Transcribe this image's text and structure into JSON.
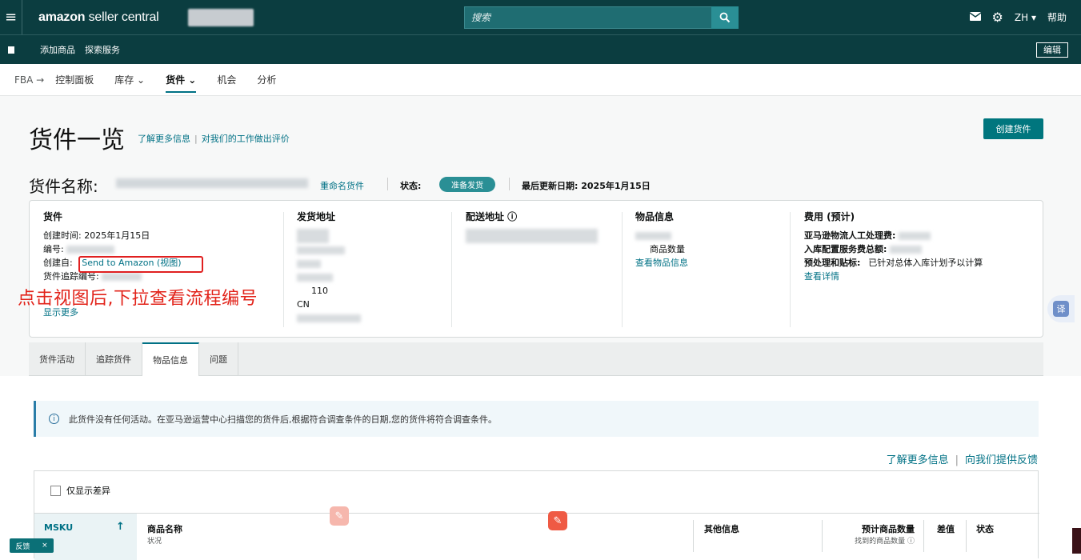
{
  "topbar": {
    "logo_main": "amazon",
    "logo_rest": " seller central",
    "search_placeholder": "搜索",
    "lang": "ZH ▾",
    "help": "帮助"
  },
  "subbar": {
    "links": [
      "添加商品",
      "探索服务"
    ],
    "edit": "编辑"
  },
  "nav": {
    "root": "FBA →",
    "items": [
      "控制面板",
      "库存 ⌄",
      "货件 ⌄",
      "机会",
      "分析"
    ]
  },
  "header": {
    "title": "货件一览",
    "learn_more": "了解更多信息",
    "sep": "|",
    "rate": "对我们的工作做出评价",
    "create_button": "创建货件"
  },
  "shipment": {
    "name_label": "货件名称:",
    "rename": "重命名货件",
    "status_label": "状态:",
    "status_value": "准备发货",
    "updated": "最后更新日期: 2025年1月15日"
  },
  "card": {
    "shipment": {
      "title": "货件",
      "created_time": "创建时间: 2025年1月15日",
      "number_label": "编号:",
      "created_from_label": "创建自:",
      "created_from_link": "Send to Amazon (视图)",
      "tracking_label": "货件追踪编号:",
      "show_more": "显示更多"
    },
    "ship_from": {
      "title": "发货地址",
      "postal": "110",
      "country": "CN"
    },
    "ship_to": {
      "title": "配送地址 ⓘ"
    },
    "items": {
      "title": "物品信息",
      "qty_label": "商品数量",
      "view_link": "查看物品信息"
    },
    "fees": {
      "title": "费用 (预计)",
      "labor": "亚马逊物流人工处理费:",
      "placement": "入库配置服务费总额:",
      "prep": "预处理和贴标:",
      "prep_value": "已针对总体入库计划予以计算",
      "details": "查看详情"
    }
  },
  "annotation": "点击视图后,下拉查看流程编号",
  "tabs": [
    "货件活动",
    "追踪货件",
    "物品信息",
    "问题"
  ],
  "alert": {
    "icon": "info-icon",
    "text": "此货件没有任何活动。在亚马逊运营中心扫描您的货件后,根据符合调查条件的日期,您的货件将符合调查条件。"
  },
  "links2": {
    "learn_more": "了解更多信息",
    "sep": "|",
    "feedback": "向我们提供反馈"
  },
  "table": {
    "only_diff": "仅显示差异",
    "columns": {
      "msku": "MSKU",
      "sort": "↑",
      "name": "商品名称",
      "name_sub": "状况",
      "other": "其他信息",
      "expected": "预计商品数量",
      "expected_sub": "找到的商品数量 ⓘ",
      "diff": "差值",
      "status": "状态"
    }
  },
  "widgets": {
    "translate": "译",
    "feedback": "反馈",
    "close": "×"
  }
}
